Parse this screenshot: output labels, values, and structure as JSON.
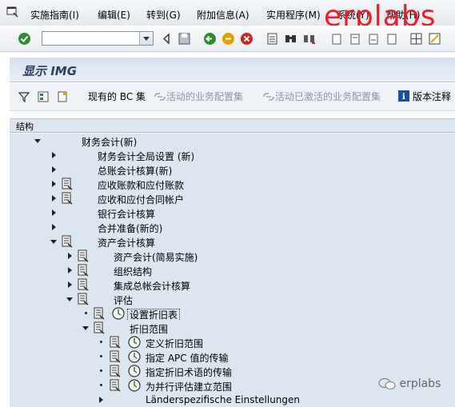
{
  "menu": {
    "items": [
      "实施指南(I)",
      "编辑(E)",
      "转到(G)",
      "附加信息(A)",
      "实用程序(M)",
      "系统(Y)",
      "帮助(H)"
    ]
  },
  "watermark": {
    "top": "erplabs",
    "bottom": "erplabs"
  },
  "toolbar": {
    "command_value": ""
  },
  "title": "显示 IMG",
  "app_toolbar": {
    "bc_sets": "现有的 BC 集",
    "active_business_config": "活动的业务配置集",
    "activated_business_config": "活动已激活的业务配置集",
    "release_notes": "版本注释"
  },
  "tree": {
    "header": "结构",
    "rows": [
      {
        "label": "财务会计(新)"
      },
      {
        "label": "财务会计全局设置 (新)"
      },
      {
        "label": "总账会计核算(新)"
      },
      {
        "label": "应收账款和应付账款"
      },
      {
        "label": "应收和应付合同帐户"
      },
      {
        "label": "银行会计核算"
      },
      {
        "label": "合并准备(新的)"
      },
      {
        "label": "资产会计核算"
      },
      {
        "label": "资产会计(简易实施)"
      },
      {
        "label": "组织结构"
      },
      {
        "label": "集成总帐会计核算"
      },
      {
        "label": "评估"
      },
      {
        "label": "设置折旧表"
      },
      {
        "label": "折旧范围"
      },
      {
        "label": "定义折旧范围"
      },
      {
        "label": "指定 APC 值的传输"
      },
      {
        "label": "指定折旧术语的传输"
      },
      {
        "label": "为并行评估建立范围"
      },
      {
        "label": "Länderspezifische Einstellungen"
      }
    ]
  },
  "colors": {
    "row_bg": "#dce6f0",
    "accent_red": "#e8202a",
    "title_color": "#2b3f5c"
  }
}
